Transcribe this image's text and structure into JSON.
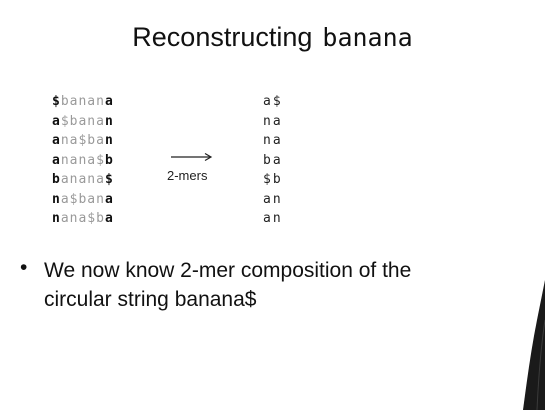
{
  "slide": {
    "title": "Reconstructing",
    "title_word": "banana",
    "rotations": [
      {
        "first": "$",
        "middle": "banan",
        "last": "a"
      },
      {
        "first": "a",
        "middle": "$bana",
        "last": "n"
      },
      {
        "first": "a",
        "middle": "na$ba",
        "last": "n"
      },
      {
        "first": "a",
        "middle": "nana$",
        "last": "b"
      },
      {
        "first": "b",
        "middle": "anana",
        "last": "$"
      },
      {
        "first": "n",
        "middle": "a$ban",
        "last": "a"
      },
      {
        "first": "n",
        "middle": "ana$b",
        "last": "a"
      }
    ],
    "arrow_label": "2-mers",
    "kmers": [
      "a$",
      "na",
      "na",
      "ba",
      "$b",
      "an",
      "an"
    ],
    "bullet_marker": "•",
    "bullet_line1": "We now know 2-mer composition of the",
    "bullet_line2_prefix": "circular string",
    "bullet_line2_word": "banana$"
  },
  "colors": {
    "text": "#111111",
    "faded_text": "#9a9a9a",
    "background": "#ffffff",
    "figure": "#1a1a1a"
  }
}
